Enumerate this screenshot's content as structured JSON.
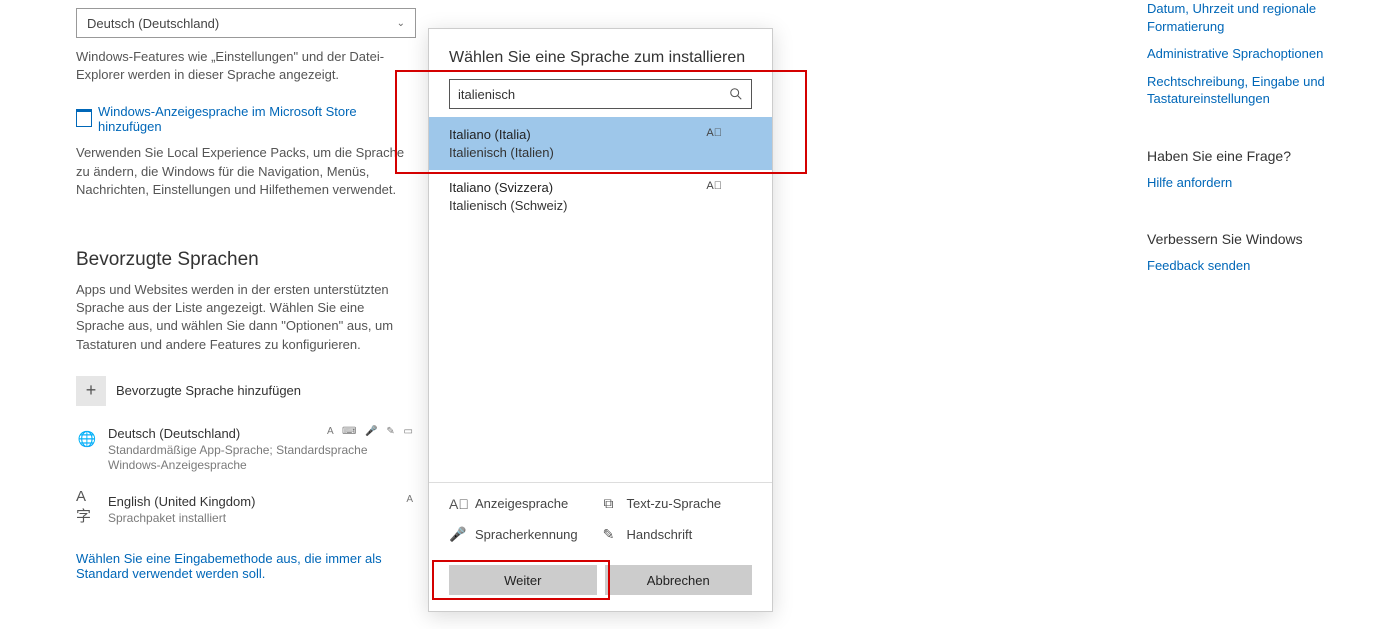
{
  "display_lang_dropdown": "Deutsch (Deutschland)",
  "display_lang_desc": "Windows-Features wie „Einstellungen\" und der Datei-Explorer werden in dieser Sprache angezeigt.",
  "store_link": "Windows-Anzeigesprache im Microsoft Store hinzufügen",
  "store_desc": "Verwenden Sie Local Experience Packs, um die Sprache zu ändern, die Windows für die Navigation, Menüs, Nachrichten, Einstellungen und Hilfethemen verwendet.",
  "preferred_heading": "Bevorzugte Sprachen",
  "preferred_desc": "Apps und Websites werden in der ersten unterstützten Sprache aus der Liste angezeigt. Wählen Sie eine Sprache aus, und wählen Sie dann \"Optionen\" aus, um Tastaturen und andere Features zu konfigurieren.",
  "add_pref_label": "Bevorzugte Sprache hinzufügen",
  "langs": [
    {
      "title": "Deutsch (Deutschland)",
      "sub": "Standardmäßige App-Sprache; Standardsprache Windows-Anzeigesprache"
    },
    {
      "title": "English (United Kingdom)",
      "sub": "Sprachpaket installiert"
    }
  ],
  "input_method_link": "Wählen Sie eine Eingabemethode aus, die immer als Standard verwendet werden soll.",
  "sidebar": {
    "links": [
      "Datum, Uhrzeit und regionale Formatierung",
      "Administrative Sprachoptionen",
      "Rechtschreibung, Eingabe und Tastatureinstellungen"
    ],
    "faq_heading": "Haben Sie eine Frage?",
    "faq_link": "Hilfe anfordern",
    "feedback_heading": "Verbessern Sie Windows",
    "feedback_link": "Feedback senden"
  },
  "dialog": {
    "title": "Wählen Sie eine Sprache zum installieren",
    "search_value": "italienisch",
    "results": [
      {
        "native": "Italiano (Italia)",
        "local": "Italienisch (Italien)",
        "selected": true
      },
      {
        "native": "Italiano (Svizzera)",
        "local": "Italienisch (Schweiz)",
        "selected": false
      }
    ],
    "caps": {
      "display": "Anzeigesprache",
      "tts": "Text-zu-Sprache",
      "speech": "Spracherkennung",
      "handwriting": "Handschrift"
    },
    "next": "Weiter",
    "cancel": "Abbrechen"
  }
}
